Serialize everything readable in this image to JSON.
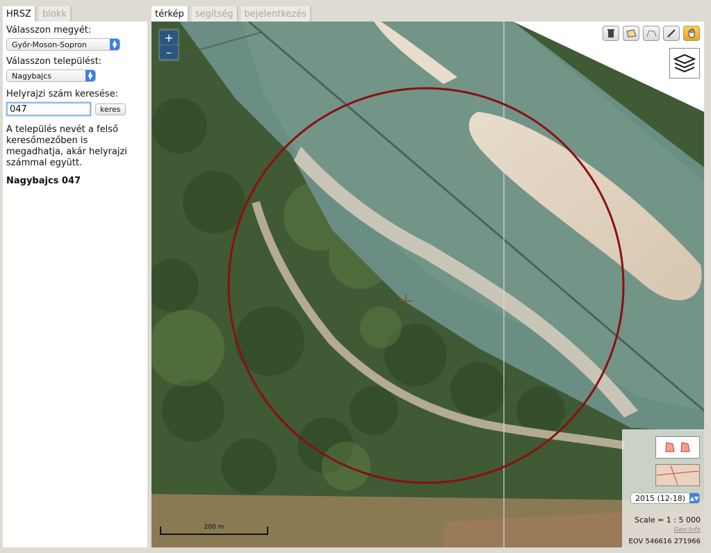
{
  "left_tabs": [
    {
      "label": "HRSZ",
      "active": true
    },
    {
      "label": "blokk",
      "active": false
    }
  ],
  "right_tabs": [
    {
      "label": "térkép",
      "active": true
    },
    {
      "label": "segítség",
      "active": false
    },
    {
      "label": "bejelentkezés",
      "active": false
    }
  ],
  "sidebar": {
    "county_label": "Válasszon megyét:",
    "county_value": "Győr-Moson-Sopron",
    "settlement_label": "Válasszon települést:",
    "settlement_value": "Nagybajcs",
    "parcel_label": "Helyrajzi szám keresése:",
    "parcel_value": "047",
    "search_button": "keres",
    "hint": "A település nevét a felső keresőmezőben is megadhatja, akár helyrajzi számmal együtt.",
    "result": "Nagybajcs 047"
  },
  "map": {
    "zoom_in": "+",
    "zoom_out": "–",
    "year_select": "2015 (12-18)",
    "scale": "Scale = 1 : 5 000",
    "credits": "Geo-Info",
    "eov": "EOV 546616 271966",
    "scalebar_label": "200 m",
    "highlight_color": "#8b0f12"
  },
  "icons": {
    "tools": [
      "trash-icon",
      "polygon-icon",
      "line-icon",
      "pencil-icon",
      "hand-icon"
    ],
    "layers": "layers-icon"
  }
}
